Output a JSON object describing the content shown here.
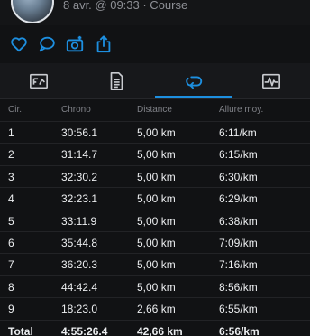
{
  "activity": {
    "subtitle": "8 avr. @ 09:33 · Course"
  },
  "actions": [
    {
      "name": "like-icon"
    },
    {
      "name": "comment-icon"
    },
    {
      "name": "camera-icon"
    },
    {
      "name": "share-icon"
    }
  ],
  "tabs": [
    {
      "name": "tab-overview",
      "icon": "summary-icon"
    },
    {
      "name": "tab-details",
      "icon": "document-icon"
    },
    {
      "name": "tab-laps",
      "icon": "laps-icon",
      "active": true
    },
    {
      "name": "tab-graphs",
      "icon": "graph-icon"
    }
  ],
  "colors": {
    "accent": "#1d8fe0",
    "background": "#111214"
  },
  "laps": {
    "headers": [
      "Cir.",
      "Chrono",
      "Distance",
      "Allure moy."
    ],
    "rows": [
      [
        "1",
        "30:56.1",
        "5,00 km",
        "6:11/km"
      ],
      [
        "2",
        "31:14.7",
        "5,00 km",
        "6:15/km"
      ],
      [
        "3",
        "32:30.2",
        "5,00 km",
        "6:30/km"
      ],
      [
        "4",
        "32:23.1",
        "5,00 km",
        "6:29/km"
      ],
      [
        "5",
        "33:11.9",
        "5,00 km",
        "6:38/km"
      ],
      [
        "6",
        "35:44.8",
        "5,00 km",
        "7:09/km"
      ],
      [
        "7",
        "36:20.3",
        "5,00 km",
        "7:16/km"
      ],
      [
        "8",
        "44:42.4",
        "5,00 km",
        "8:56/km"
      ],
      [
        "9",
        "18:23.0",
        "2,66 km",
        "6:55/km"
      ]
    ],
    "total": [
      "Total",
      "4:55:26.4",
      "42,66 km",
      "6:56/km"
    ]
  }
}
